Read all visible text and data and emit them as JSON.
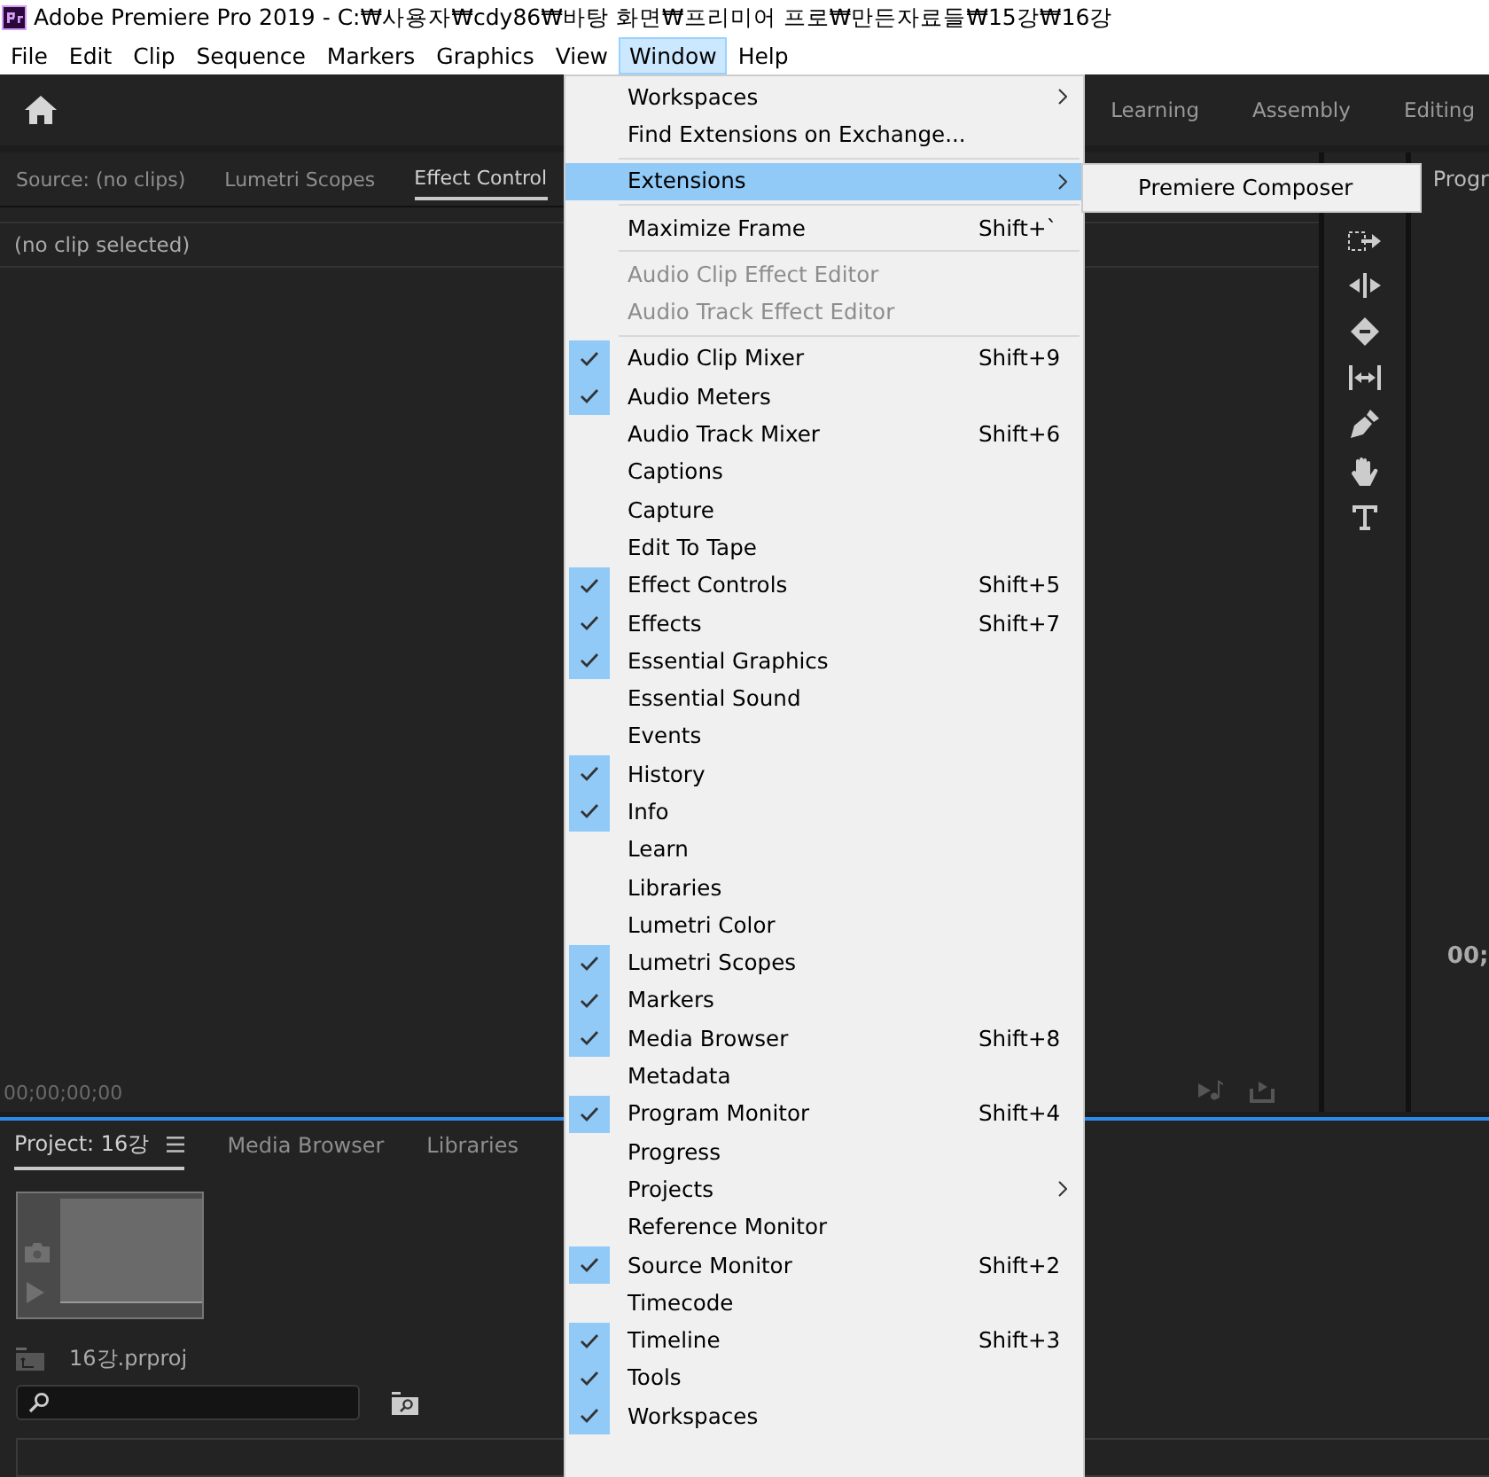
{
  "title_bar": {
    "title": "Adobe Premiere Pro 2019 - C:₩사용자₩cdy86₩바탕 화면₩프리미어 프로₩만든자료들₩15강₩16강"
  },
  "menu_bar": [
    {
      "label": "File",
      "selected": false
    },
    {
      "label": "Edit",
      "selected": false
    },
    {
      "label": "Clip",
      "selected": false
    },
    {
      "label": "Sequence",
      "selected": false
    },
    {
      "label": "Markers",
      "selected": false
    },
    {
      "label": "Graphics",
      "selected": false
    },
    {
      "label": "View",
      "selected": false
    },
    {
      "label": "Window",
      "selected": true
    },
    {
      "label": "Help",
      "selected": false
    }
  ],
  "workspace_tabs": [
    "Learning",
    "Assembly",
    "Editing"
  ],
  "source_panel": {
    "tabs": [
      {
        "label": "Source: (no clips)",
        "selected": false
      },
      {
        "label": "Lumetri Scopes",
        "selected": false
      },
      {
        "label": "Effect Control",
        "selected": true
      }
    ],
    "clip_label": "(no clip selected)",
    "timecode": "00;00;00;00"
  },
  "program_panel": {
    "title": "Progr",
    "timecode": "00;"
  },
  "project_panel": {
    "tabs": [
      {
        "label": "Project: 16강",
        "selected": true
      },
      {
        "label": "Media Browser",
        "selected": false
      },
      {
        "label": "Libraries",
        "selected": false
      }
    ],
    "file_name": "16강.prproj"
  },
  "window_menu": [
    {
      "kind": "item",
      "label": "Workspaces",
      "submenu": true
    },
    {
      "kind": "item",
      "label": "Find Extensions on Exchange..."
    },
    {
      "kind": "separator"
    },
    {
      "kind": "item",
      "label": "Extensions",
      "submenu": true,
      "selected": true
    },
    {
      "kind": "separator"
    },
    {
      "kind": "item",
      "label": "Maximize Frame",
      "shortcut": "Shift+`"
    },
    {
      "kind": "separator"
    },
    {
      "kind": "item",
      "label": "Audio Clip Effect Editor",
      "disabled": true
    },
    {
      "kind": "item",
      "label": "Audio Track Effect Editor",
      "disabled": true
    },
    {
      "kind": "separator"
    },
    {
      "kind": "item",
      "label": "Audio Clip Mixer",
      "shortcut": "Shift+9",
      "checked": true
    },
    {
      "kind": "item",
      "label": "Audio Meters",
      "checked": true
    },
    {
      "kind": "item",
      "label": "Audio Track Mixer",
      "shortcut": "Shift+6",
      "checked": false
    },
    {
      "kind": "item",
      "label": "Captions",
      "checked": false
    },
    {
      "kind": "item",
      "label": "Capture",
      "checked": false
    },
    {
      "kind": "item",
      "label": "Edit To Tape",
      "checked": false
    },
    {
      "kind": "item",
      "label": "Effect Controls",
      "shortcut": "Shift+5",
      "checked": true
    },
    {
      "kind": "item",
      "label": "Effects",
      "shortcut": "Shift+7",
      "checked": true
    },
    {
      "kind": "item",
      "label": "Essential Graphics",
      "checked": true
    },
    {
      "kind": "item",
      "label": "Essential Sound",
      "checked": false
    },
    {
      "kind": "item",
      "label": "Events",
      "checked": false
    },
    {
      "kind": "item",
      "label": "History",
      "checked": true
    },
    {
      "kind": "item",
      "label": "Info",
      "checked": true
    },
    {
      "kind": "item",
      "label": "Learn",
      "checked": false
    },
    {
      "kind": "item",
      "label": "Libraries",
      "checked": false
    },
    {
      "kind": "item",
      "label": "Lumetri Color",
      "checked": false
    },
    {
      "kind": "item",
      "label": "Lumetri Scopes",
      "checked": true
    },
    {
      "kind": "item",
      "label": "Markers",
      "checked": true
    },
    {
      "kind": "item",
      "label": "Media Browser",
      "shortcut": "Shift+8",
      "checked": true
    },
    {
      "kind": "item",
      "label": "Metadata",
      "checked": false
    },
    {
      "kind": "item",
      "label": "Program Monitor",
      "shortcut": "Shift+4",
      "checked": true
    },
    {
      "kind": "item",
      "label": "Progress",
      "checked": false
    },
    {
      "kind": "item",
      "label": "Projects",
      "submenu": true,
      "checked": false
    },
    {
      "kind": "item",
      "label": "Reference Monitor",
      "checked": false
    },
    {
      "kind": "item",
      "label": "Source Monitor",
      "shortcut": "Shift+2",
      "checked": true
    },
    {
      "kind": "item",
      "label": "Timecode",
      "checked": false
    },
    {
      "kind": "item",
      "label": "Timeline",
      "shortcut": "Shift+3",
      "checked": true
    },
    {
      "kind": "item",
      "label": "Tools",
      "checked": true
    },
    {
      "kind": "item",
      "label": "Workspaces",
      "checked": true
    }
  ],
  "extensions_submenu": [
    "Premiere Composer"
  ]
}
